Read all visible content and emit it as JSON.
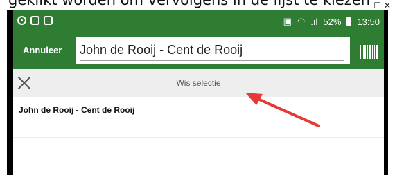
{
  "caption": {
    "text": "geklikt worden om vervolgens in de lijst te kiezen"
  },
  "statusbar": {
    "battery": "52%",
    "time": "13:50"
  },
  "toolbar": {
    "cancel_label": "Annuleer",
    "search_value": "John de Rooij - Cent de Rooij"
  },
  "selection": {
    "clear_label": "Wis selectie"
  },
  "results": [
    {
      "label": "John de Rooij - Cent de Rooij"
    }
  ],
  "colors": {
    "toolbar": "#2e7d32",
    "arrow": "#e53935"
  },
  "icons": [
    "eye-icon",
    "sync-icon",
    "image-icon",
    "sim-icon",
    "wifi-icon",
    "signal-icon",
    "battery-icon",
    "barcode-icon",
    "close-icon",
    "annotation-arrow"
  ]
}
